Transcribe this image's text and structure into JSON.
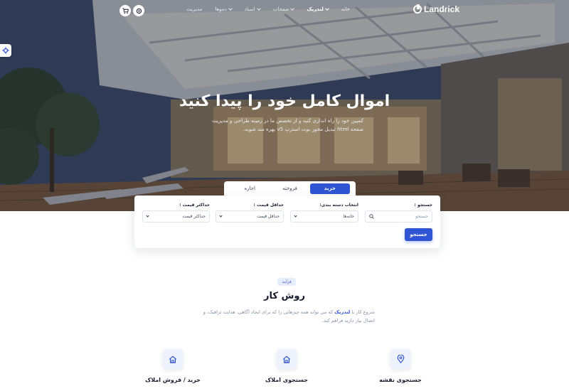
{
  "brand": {
    "name": "Landrick"
  },
  "nav": {
    "items": [
      {
        "label": "خانه",
        "active": false,
        "dropdown": false
      },
      {
        "label": "لندریک",
        "active": true,
        "dropdown": true
      },
      {
        "label": "صفحات",
        "active": false,
        "dropdown": true
      },
      {
        "label": "اسناد",
        "active": false,
        "dropdown": true
      },
      {
        "label": "دموها",
        "active": false,
        "dropdown": true
      },
      {
        "label": "مدیریت",
        "active": false,
        "dropdown": false
      }
    ],
    "icons": [
      "settings-icon",
      "cart-icon"
    ]
  },
  "hero": {
    "title": "اموال کامل خود را پیدا کنید",
    "subtitle": "کمپین خود را راه اندازی کنید و از تخصص ما در زمینه طراحی و مدیریت صفحه html تبدیل محور بوت استرپ v5 بهره مند شوید."
  },
  "search": {
    "tabs": [
      {
        "label": "خرید",
        "active": true
      },
      {
        "label": "فروخته",
        "active": false
      },
      {
        "label": "اجاره",
        "active": false
      }
    ],
    "fields": {
      "query": {
        "label": "جستجو :",
        "placeholder": "جستجو"
      },
      "category": {
        "label": "انتخاب دسته بندی:",
        "value": "خانه‌ها"
      },
      "min_price": {
        "label": "حداقل قیمت :",
        "value": "حداقل قیمت"
      },
      "max_price": {
        "label": "حداکثر قیمت :",
        "value": "حداکثر قیمت"
      }
    },
    "submit_label": "جستجو"
  },
  "process": {
    "badge": "فرآیند",
    "title": "روش کار",
    "desc_before": "شروع کار با",
    "desc_brand": "لندریک",
    "desc_after": "که می تواند همه چیزهایی را که برای ایجاد آگاهی، هدایت ترافیک، و اتصال نیاز دارید فراهم کند.",
    "features": [
      {
        "label": "جستجوی نقشه",
        "icon": "map-pin-icon"
      },
      {
        "label": "جستجوی املاک",
        "icon": "home-icon"
      },
      {
        "label": "خرید / فروش املاک",
        "icon": "home-icon"
      }
    ]
  },
  "colors": {
    "primary": "#2f55d4",
    "text": "#161c2d",
    "muted": "#8492a6",
    "white": "#ffffff"
  }
}
